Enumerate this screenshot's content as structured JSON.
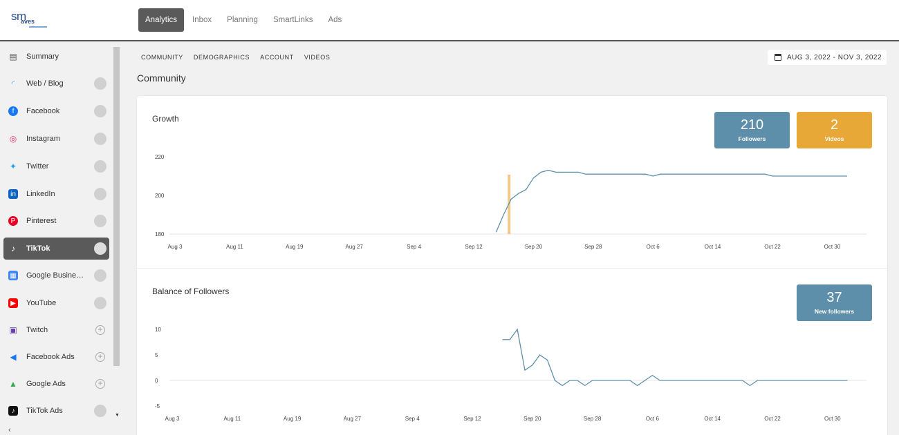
{
  "app": {
    "logo_main": "sm",
    "logo_sub": "aves"
  },
  "nav": {
    "tabs": [
      "Analytics",
      "Inbox",
      "Planning",
      "SmartLinks",
      "Ads"
    ],
    "active": "Analytics"
  },
  "sidebar": {
    "items": [
      {
        "label": "Summary",
        "icon": "clipboard-icon",
        "status": "none"
      },
      {
        "label": "Web / Blog",
        "icon": "rss-icon",
        "status": "dot"
      },
      {
        "label": "Facebook",
        "icon": "facebook-icon",
        "status": "dot"
      },
      {
        "label": "Instagram",
        "icon": "instagram-icon",
        "status": "dot"
      },
      {
        "label": "Twitter",
        "icon": "twitter-icon",
        "status": "dot"
      },
      {
        "label": "LinkedIn",
        "icon": "linkedin-icon",
        "status": "dot"
      },
      {
        "label": "Pinterest",
        "icon": "pinterest-icon",
        "status": "dot"
      },
      {
        "label": "TikTok",
        "icon": "tiktok-icon",
        "status": "dot",
        "active": true
      },
      {
        "label": "Google Business Profile",
        "icon": "google-business-icon",
        "status": "dot"
      },
      {
        "label": "YouTube",
        "icon": "youtube-icon",
        "status": "dot"
      },
      {
        "label": "Twitch",
        "icon": "twitch-icon",
        "status": "plus"
      },
      {
        "label": "Facebook Ads",
        "icon": "megaphone-icon",
        "status": "plus"
      },
      {
        "label": "Google Ads",
        "icon": "google-ads-icon",
        "status": "plus"
      },
      {
        "label": "TikTok Ads",
        "icon": "tiktok-ads-icon",
        "status": "dot"
      }
    ]
  },
  "subnav": {
    "tabs": [
      "COMMUNITY",
      "DEMOGRAPHICS",
      "ACCOUNT",
      "VIDEOS"
    ]
  },
  "date_range": "AUG 3, 2022 - NOV 3, 2022",
  "page_title": "Community",
  "growth": {
    "title": "Growth",
    "stats": [
      {
        "value": "210",
        "label": "Followers",
        "color": "#5e8faa"
      },
      {
        "value": "2",
        "label": "Videos",
        "color": "#e8a838"
      }
    ]
  },
  "balance": {
    "title": "Balance of Followers",
    "stats": [
      {
        "value": "37",
        "label": "New followers",
        "color": "#5e8faa"
      }
    ]
  },
  "colors": {
    "line": "#5e8faa",
    "video_marker": "#f3c98b",
    "active_bg": "#5a5a5a"
  },
  "chart_data": [
    {
      "type": "line",
      "title": "Growth",
      "x_ticks": [
        "Aug 3",
        "Aug 11",
        "Aug 19",
        "Aug 27",
        "Sep 4",
        "Sep 12",
        "Sep 20",
        "Sep 28",
        "Oct 6",
        "Oct 14",
        "Oct 22",
        "Oct 30"
      ],
      "x_range": [
        "2022-08-03",
        "2022-11-03"
      ],
      "ylim": [
        180,
        220
      ],
      "y_ticks": [
        180,
        200,
        220
      ],
      "series": [
        {
          "x": [
            "2022-09-15",
            "2022-09-16",
            "2022-09-17",
            "2022-09-18",
            "2022-09-19",
            "2022-09-20",
            "2022-09-21",
            "2022-09-22",
            "2022-09-23",
            "2022-09-24",
            "2022-09-25",
            "2022-09-26",
            "2022-09-27",
            "2022-09-28",
            "2022-09-29",
            "2022-09-30",
            "2022-10-01",
            "2022-10-02",
            "2022-10-03",
            "2022-10-04",
            "2022-10-05",
            "2022-10-06",
            "2022-10-07",
            "2022-10-08",
            "2022-10-09",
            "2022-10-10",
            "2022-10-11",
            "2022-10-12",
            "2022-10-13",
            "2022-10-14",
            "2022-10-15",
            "2022-10-16",
            "2022-10-17",
            "2022-10-18",
            "2022-10-19",
            "2022-10-20",
            "2022-10-21",
            "2022-10-22",
            "2022-10-23",
            "2022-10-24",
            "2022-10-25",
            "2022-10-26",
            "2022-10-27",
            "2022-10-28",
            "2022-10-29",
            "2022-10-30",
            "2022-10-31",
            "2022-11-01"
          ],
          "y": [
            181,
            190,
            198,
            201,
            203,
            209,
            212,
            213,
            212,
            212,
            212,
            212,
            211,
            211,
            211,
            211,
            211,
            211,
            211,
            211,
            211,
            210,
            211,
            211,
            211,
            211,
            211,
            211,
            211,
            211,
            211,
            211,
            211,
            211,
            211,
            211,
            211,
            210,
            210,
            210,
            210,
            210,
            210,
            210,
            210,
            210,
            210,
            210
          ]
        }
      ],
      "markers": [
        {
          "x": "2022-09-16",
          "label": ""
        }
      ],
      "grid": false
    },
    {
      "type": "line",
      "title": "Balance of Followers",
      "x_ticks": [
        "Aug 3",
        "Aug 11",
        "Aug 19",
        "Aug 27",
        "Sep 4",
        "Sep 12",
        "Sep 20",
        "Sep 28",
        "Oct 6",
        "Oct 14",
        "Oct 22",
        "Oct 30"
      ],
      "x_range": [
        "2022-08-03",
        "2022-11-03"
      ],
      "ylim": [
        -5,
        10
      ],
      "y_ticks": [
        -5,
        0,
        5,
        10
      ],
      "series": [
        {
          "x": [
            "2022-09-16",
            "2022-09-17",
            "2022-09-18",
            "2022-09-19",
            "2022-09-20",
            "2022-09-21",
            "2022-09-22",
            "2022-09-23",
            "2022-09-24",
            "2022-09-25",
            "2022-09-26",
            "2022-09-27",
            "2022-09-28",
            "2022-09-29",
            "2022-09-30",
            "2022-10-01",
            "2022-10-02",
            "2022-10-03",
            "2022-10-04",
            "2022-10-05",
            "2022-10-06",
            "2022-10-07",
            "2022-10-08",
            "2022-10-09",
            "2022-10-10",
            "2022-10-11",
            "2022-10-12",
            "2022-10-13",
            "2022-10-14",
            "2022-10-15",
            "2022-10-16",
            "2022-10-17",
            "2022-10-18",
            "2022-10-19",
            "2022-10-20",
            "2022-10-21",
            "2022-10-22",
            "2022-10-23",
            "2022-10-24",
            "2022-10-25",
            "2022-10-26",
            "2022-10-27",
            "2022-10-28",
            "2022-10-29",
            "2022-10-30",
            "2022-10-31",
            "2022-11-01"
          ],
          "y": [
            8,
            8,
            10,
            2,
            3,
            5,
            4,
            0,
            -1,
            0,
            0,
            -1,
            0,
            0,
            0,
            0,
            0,
            0,
            -1,
            0,
            1,
            0,
            0,
            0,
            0,
            0,
            0,
            0,
            0,
            0,
            0,
            0,
            0,
            -1,
            0,
            0,
            0,
            0,
            0,
            0,
            0,
            0,
            0,
            0,
            0,
            0,
            0
          ]
        }
      ],
      "grid": false
    }
  ]
}
